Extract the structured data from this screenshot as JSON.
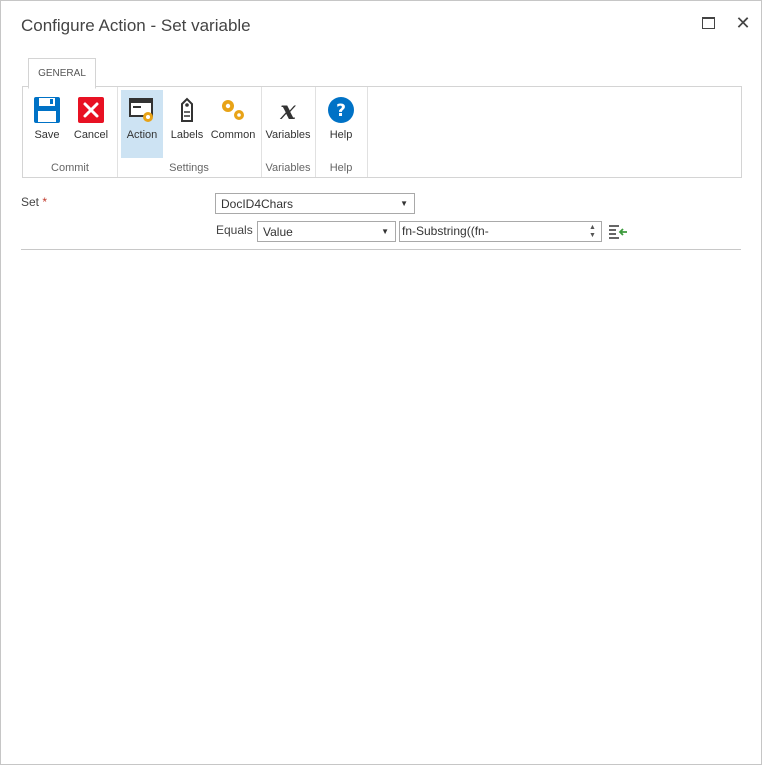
{
  "window": {
    "title": "Configure Action - Set variable"
  },
  "ribbon": {
    "tab": "GENERAL",
    "groups": [
      {
        "label": "Commit",
        "buttons": [
          {
            "label": "Save",
            "icon": "save-icon"
          },
          {
            "label": "Cancel",
            "icon": "cancel-icon"
          }
        ]
      },
      {
        "label": "Settings",
        "buttons": [
          {
            "label": "Action",
            "icon": "action-settings-icon",
            "active": true
          },
          {
            "label": "Labels",
            "icon": "tag-icon"
          },
          {
            "label": "Common",
            "icon": "gears-icon"
          }
        ]
      },
      {
        "label": "Variables",
        "buttons": [
          {
            "label": "Variables",
            "icon": "variable-x-icon"
          }
        ]
      },
      {
        "label": "Help",
        "buttons": [
          {
            "label": "Help",
            "icon": "help-icon"
          }
        ]
      }
    ]
  },
  "form": {
    "set_label": "Set",
    "required_marker": "*",
    "variable": "DocID4Chars",
    "equals_label": "Equals",
    "value_type": "Value",
    "value_text": "fn-Substring((fn-"
  },
  "colors": {
    "accent": "#0072c6",
    "active": "#cde3f3",
    "cancel": "#e81123",
    "gear": "#e8a317"
  }
}
